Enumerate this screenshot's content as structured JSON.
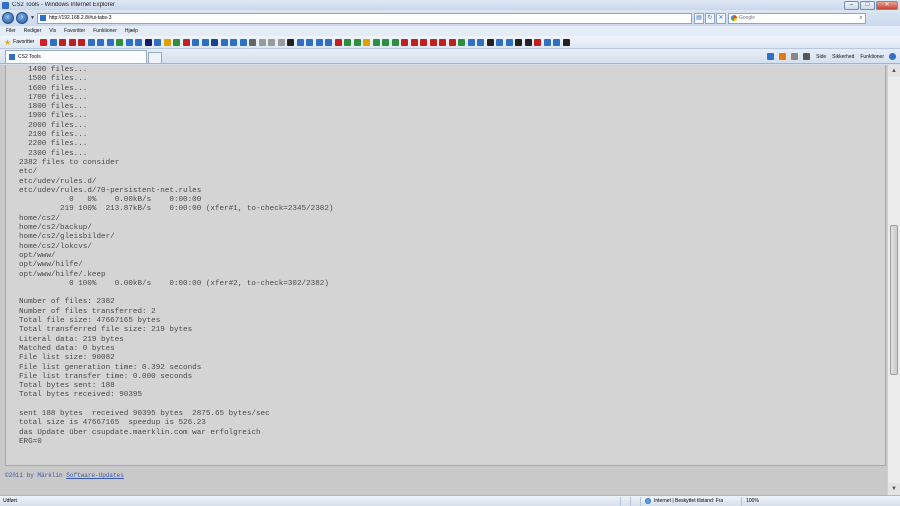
{
  "window": {
    "title": "CS2 Tools - Windows Internet Explorer",
    "buttons": {
      "minimize": "–",
      "maximize": "□",
      "close": "✕"
    }
  },
  "address": {
    "url": "http://192.168.2.8/#ui-tabs-3",
    "search_placeholder": "Google"
  },
  "menu": [
    "Filer",
    "Rediger",
    "Vis",
    "Favoritter",
    "Funktioner",
    "Hjælp"
  ],
  "favorites": {
    "label": "Favoritter",
    "icon_colors": [
      "#d42020",
      "#2f6fc4",
      "#c02020",
      "#c02020",
      "#c02020",
      "#2f6fc4",
      "#2f6fc4",
      "#2f6fc4",
      "#2f8f3f",
      "#2f6fc4",
      "#2f6fc4",
      "#1a1a6a",
      "#2f6fc4",
      "#e0a000",
      "#2f8f3f",
      "#c02020",
      "#2f6fc4",
      "#2f6fc4",
      "#1a3f8f",
      "#2f6fc4",
      "#2f6fc4",
      "#2f6fc4",
      "#666666",
      "#999999",
      "#999999",
      "#999999",
      "#222222",
      "#2f6fc4",
      "#2f6fc4",
      "#2f6fc4",
      "#2f6fc4",
      "#c02020",
      "#2f8f3f",
      "#2f8f3f",
      "#e0a000",
      "#2f8f3f",
      "#2f8f3f",
      "#2f8f3f",
      "#c02020",
      "#c02020",
      "#c02020",
      "#c02020",
      "#c02020",
      "#c02020",
      "#2f8f3f",
      "#2f6fc4",
      "#2f6fc4",
      "#222222",
      "#2f6fc4",
      "#2f6fc4",
      "#222222",
      "#222222",
      "#c02020",
      "#2f6fc4",
      "#2f6fc4",
      "#222222"
    ]
  },
  "tabs": [
    {
      "label": "CS2 Tools"
    }
  ],
  "command_bar": {
    "page": "Side",
    "safety": "Sikkerhed",
    "tools": "Funktioner"
  },
  "log_text": "  1400 files...\n  1500 files...\n  1600 files...\n  1700 files...\n  1800 files...\n  1900 files...\n  2000 files...\n  2100 files...\n  2200 files...\n  2300 files...\n2382 files to consider\netc/\netc/udev/rules.d/\netc/udev/rules.d/70-persistent-net.rules\n           0   0%    0.00kB/s    0:00:00\n         219 100%  213.87kB/s    0:00:00 (xfer#1, to-check=2345/2382)\nhome/cs2/\nhome/cs2/backup/\nhome/cs2/gleisbilder/\nhome/cs2/lokcvs/\nopt/www/\nopt/www/hilfe/\nopt/www/hilfe/.keep\n           0 100%    0.00kB/s    0:00:00 (xfer#2, to-check=302/2382)\n\nNumber of files: 2382\nNumber of files transferred: 2\nTotal file size: 47667165 bytes\nTotal transferred file size: 219 bytes\nLiteral data: 219 bytes\nMatched data: 0 bytes\nFile list size: 90082\nFile list generation time: 0.392 seconds\nFile list transfer time: 0.000 seconds\nTotal bytes sent: 188\nTotal bytes received: 90395\n\nsent 188 bytes  received 90395 bytes  2875.65 bytes/sec\ntotal size is 47667165  speedup is 526.23\ndas Update über csupdate.maerklin.com war erfolgreich\nERG=0",
  "footer": {
    "copyright": "©2011 by Märklin",
    "link": "Software-Updates"
  },
  "status": {
    "left": "Udført",
    "zone": "Internet | Beskyttet tilstand: Fra",
    "zoom": "100%"
  }
}
